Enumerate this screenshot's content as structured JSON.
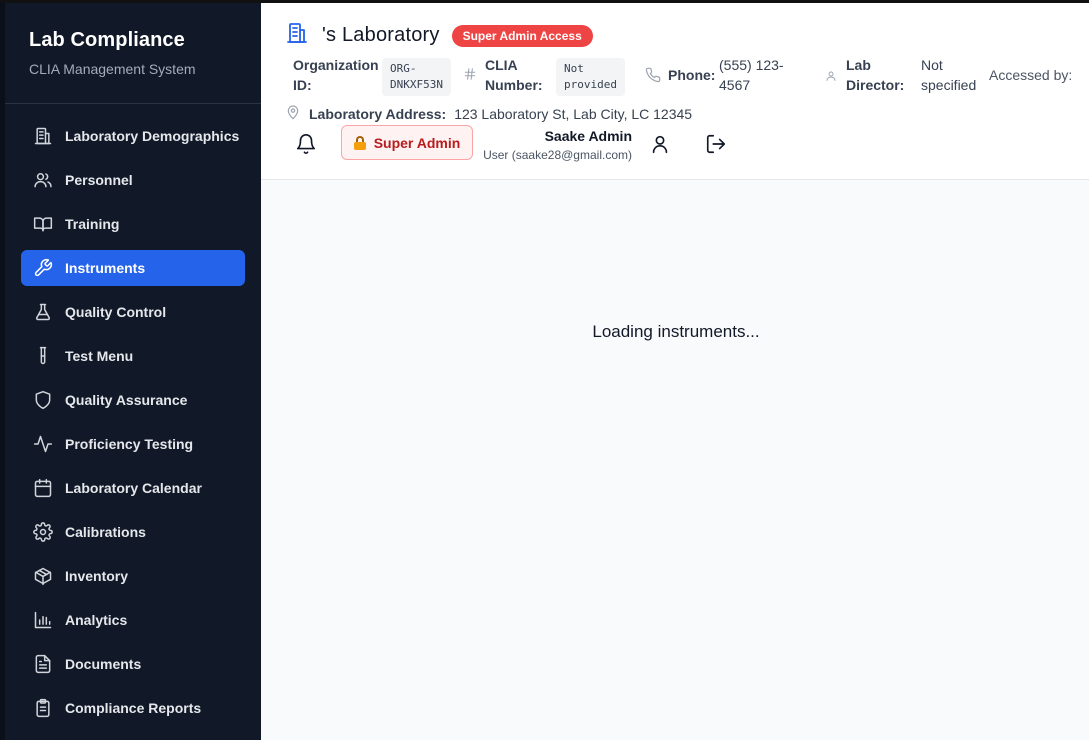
{
  "sidebar": {
    "title": "Lab Compliance",
    "subtitle": "CLIA Management System",
    "items": [
      {
        "label": "Laboratory Demographics",
        "icon": "building-icon"
      },
      {
        "label": "Personnel",
        "icon": "users-icon"
      },
      {
        "label": "Training",
        "icon": "book-icon"
      },
      {
        "label": "Instruments",
        "icon": "wrench-icon",
        "active": true
      },
      {
        "label": "Quality Control",
        "icon": "flask-icon"
      },
      {
        "label": "Test Menu",
        "icon": "test-tube-icon"
      },
      {
        "label": "Quality Assurance",
        "icon": "shield-icon"
      },
      {
        "label": "Proficiency Testing",
        "icon": "activity-icon"
      },
      {
        "label": "Laboratory Calendar",
        "icon": "calendar-icon"
      },
      {
        "label": "Calibrations",
        "icon": "gear-icon"
      },
      {
        "label": "Inventory",
        "icon": "package-icon"
      },
      {
        "label": "Analytics",
        "icon": "bar-chart-icon"
      },
      {
        "label": "Documents",
        "icon": "file-text-icon"
      },
      {
        "label": "Compliance Reports",
        "icon": "clipboard-icon"
      }
    ]
  },
  "header": {
    "lab_name": "'s Laboratory",
    "access_badge": "Super Admin Access",
    "org_id_label_1": "Organization",
    "org_id_label_2": "ID:",
    "org_id_value_1": "ORG-",
    "org_id_value_2": "DNKXF53N",
    "clia_label_1": "CLIA",
    "clia_label_2": "Number:",
    "clia_value_1": "Not",
    "clia_value_2": "provided",
    "phone_label": "Phone:",
    "phone_value_1": "(555) 123-",
    "phone_value_2": "4567",
    "director_label_1": "Lab",
    "director_label_2": "Director:",
    "director_value_1": "Not",
    "director_value_2": "specified",
    "accessed_by": "Accessed by:",
    "address_label": "Laboratory Address:",
    "address_value": "123 Laboratory St, Lab City, LC 12345",
    "role_button": "Super Admin",
    "user_name": "Saake Admin",
    "user_email": "User (saake28@gmail.com)"
  },
  "main": {
    "loading_text": "Loading instruments..."
  },
  "colors": {
    "sidebar_bg": "#111827",
    "active_item": "#2563eb",
    "badge": "#ef4444",
    "accent": "#2563eb"
  }
}
